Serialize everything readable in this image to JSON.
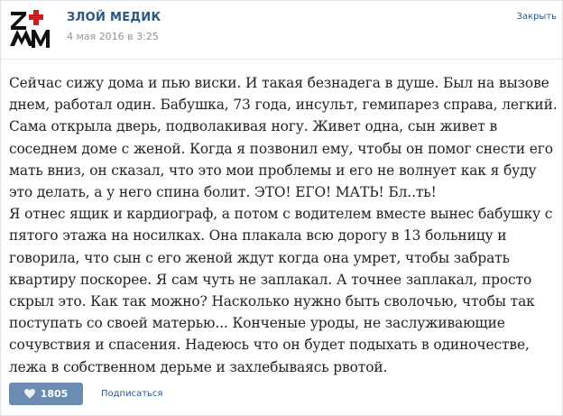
{
  "post": {
    "author": "ЗЛОЙ МЕДИК",
    "date": "4 мая 2016 в 3:25",
    "close_label": "Закрыть",
    "text": "Сейчас сижу дома и пью виски. И такая безнадега в душе. Был на вызове днем, работал один. Бабушка, 73 года, инсульт, гемипарез справа, легкий. Сама открыла дверь, подволакивая ногу. Живет одна, сын живет в соседнем доме с женой. Когда я позвонил ему, чтобы он помог снести его мать вниз, он сказал, что это мои проблемы и его не волнует как я буду это делать, а у него спина болит. ЭТО! ЕГО! МАТЬ! Бл..ть!\nЯ отнес ящик и кардиограф, а потом с водителем вместе вынес бабушку с пятого этажа на носилках. Она плакала всю дорогу в 13 больницу и говорила, что сын с его женой ждут когда она умрет, чтобы забрать квартиру поскорее. Я сам чуть не заплакал. А точнее заплакал, просто скрыл это. Как так можно? Насколько нужно быть сволочью, чтобы так поступать со своей матерью... Конченые уроды, не заслуживающие сочувствия и спасения. Надеюсь что он будет подыхать в одиночестве, лежа в собственном дерьме и захлебываясь рвотой.",
    "avatar_icon": "zm-logo-icon",
    "accent_color": "#2a5885",
    "like_button_color": "#6a8cb0"
  },
  "actions": {
    "like_icon": "heart-icon",
    "like_count": "1805",
    "subscribe_label": "Подписаться"
  }
}
